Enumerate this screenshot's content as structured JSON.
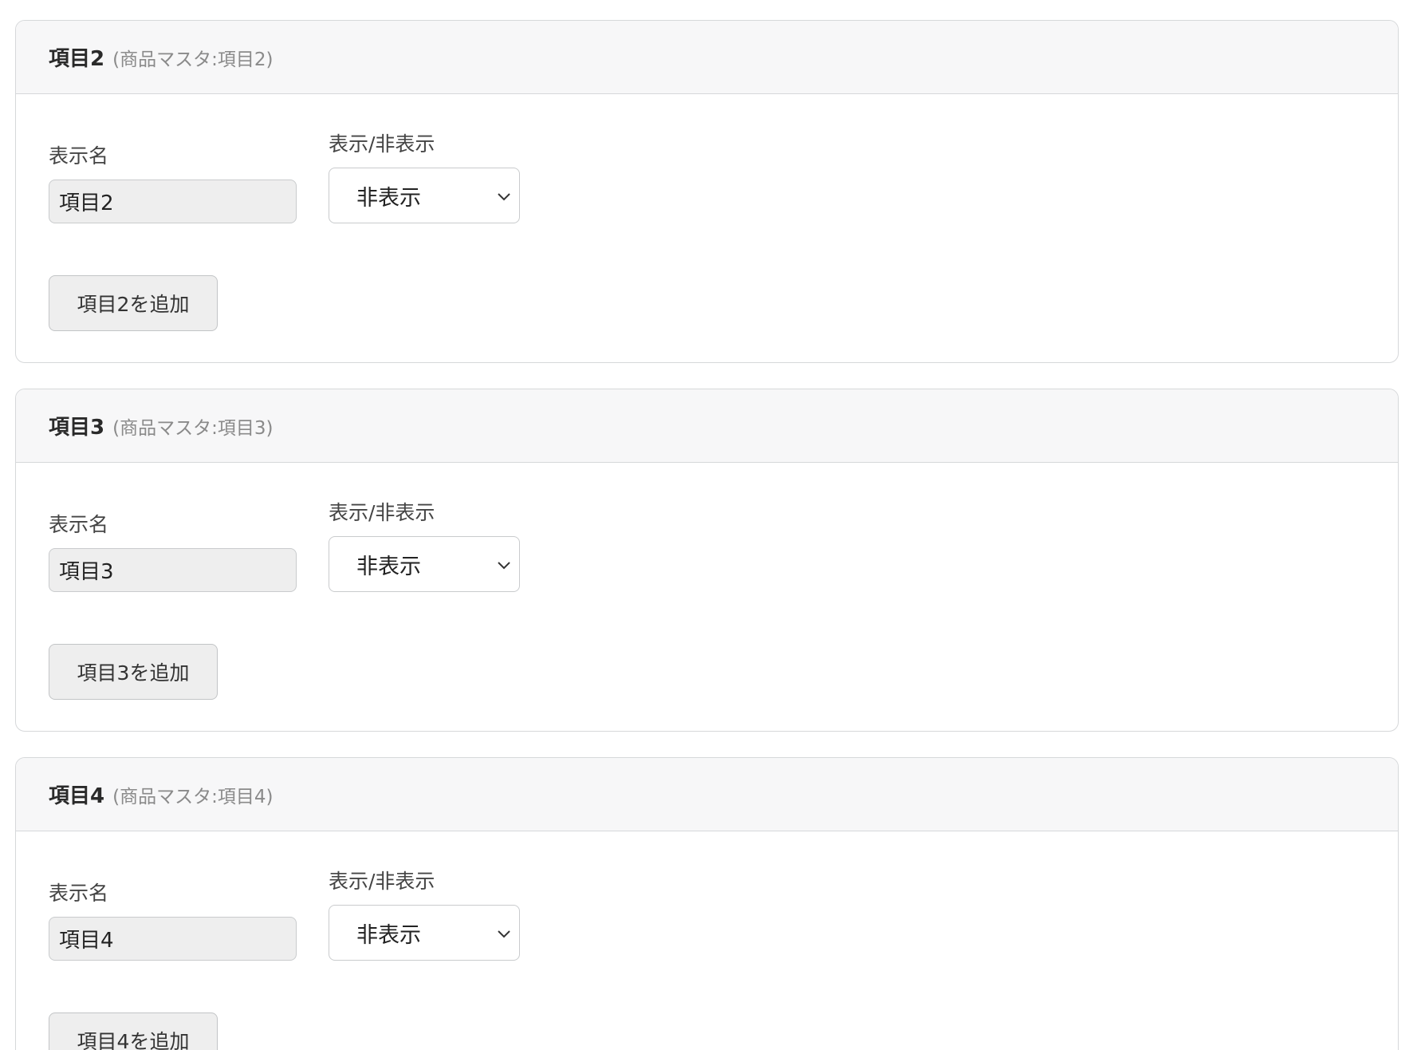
{
  "sections": [
    {
      "title": "項目2",
      "subtitle": "(商品マスタ:項目2)",
      "display_name_label": "表示名",
      "display_name_value": "項目2",
      "visibility_label": "表示/非表示",
      "visibility_value": "非表示",
      "add_button_label": "項目2を追加"
    },
    {
      "title": "項目3",
      "subtitle": "(商品マスタ:項目3)",
      "display_name_label": "表示名",
      "display_name_value": "項目3",
      "visibility_label": "表示/非表示",
      "visibility_value": "非表示",
      "add_button_label": "項目3を追加"
    },
    {
      "title": "項目4",
      "subtitle": "(商品マスタ:項目4)",
      "display_name_label": "表示名",
      "display_name_value": "項目4",
      "visibility_label": "表示/非表示",
      "visibility_value": "非表示",
      "add_button_label": "項目4を追加"
    }
  ],
  "icons": {
    "select_chevron": "chevron-down-icon"
  },
  "colors": {
    "header_background": "#f7f7f8",
    "border": "#d6d8da",
    "input_background": "#eeeeee",
    "button_background": "#eeeeee",
    "subtitle_text": "#8a8a8a"
  }
}
